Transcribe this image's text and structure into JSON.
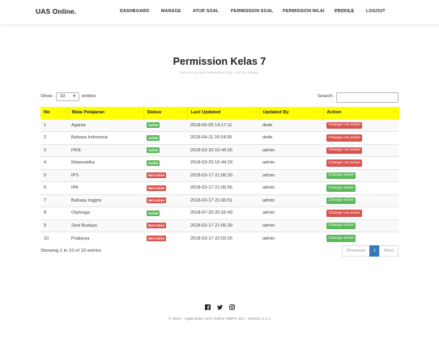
{
  "app": {
    "brand": "UAS Online."
  },
  "nav": {
    "items": [
      {
        "label": "DASHBOARD"
      },
      {
        "label": "MANAGE"
      },
      {
        "label": "ATUR SOAL"
      },
      {
        "label": "PERMISSION SOAL"
      },
      {
        "label": "PERMISSION NILAI"
      },
      {
        "label": "PROFILE"
      },
      {
        "label": "LOGOUT"
      }
    ],
    "active_item": "PROFILE"
  },
  "page": {
    "title": "Permission Kelas 7",
    "subtitle": "SERVITAH UNR REHBURA SOAL UNTUK SISWA"
  },
  "controls": {
    "show_label": "Show",
    "entries_value": "10",
    "entries_label": "entries",
    "search_label": "Search:",
    "search_value": ""
  },
  "table": {
    "columns": [
      "No",
      "Mata Pelajaran",
      "Status",
      "Last Updated",
      "Updated By",
      "Action"
    ],
    "rows": [
      {
        "no": "1",
        "subject": "Agama",
        "status": "Active",
        "updated": "2018-06-05 14:17:11",
        "by": "dede",
        "action": "Change not active"
      },
      {
        "no": "2",
        "subject": "Bahasa Indonesia",
        "status": "Active",
        "updated": "2018-04-11 20:24:36",
        "by": "dede",
        "action": "Change not active"
      },
      {
        "no": "3",
        "subject": "PKN",
        "status": "Active",
        "updated": "2018-03-20 10:44:26",
        "by": "admin",
        "action": "Change not active"
      },
      {
        "no": "4",
        "subject": "Matematika",
        "status": "Active",
        "updated": "2018-03-20 10:44:29",
        "by": "admin",
        "action": "Change not active"
      },
      {
        "no": "5",
        "subject": "IPS",
        "status": "Not Active",
        "updated": "2018-03-17 21:06:30",
        "by": "admin",
        "action": "Change active"
      },
      {
        "no": "6",
        "subject": "IPA",
        "status": "Not Active",
        "updated": "2018-03-17 21:06:56",
        "by": "admin",
        "action": "Change active"
      },
      {
        "no": "7",
        "subject": "Bahasa Inggris",
        "status": "Not Active",
        "updated": "2018-03-17 21:06:51",
        "by": "admin",
        "action": "Change active"
      },
      {
        "no": "8",
        "subject": "Olahraga",
        "status": "Active",
        "updated": "2018-07-20 20:16:49",
        "by": "admin",
        "action": "Change not active"
      },
      {
        "no": "9",
        "subject": "Seni Budaya",
        "status": "Not Active",
        "updated": "2018-03-17 21:06:39",
        "by": "admin",
        "action": "Change active"
      },
      {
        "no": "10",
        "subject": "Prakarya",
        "status": "Not Active",
        "updated": "2018-03-17 22:03:25",
        "by": "admin",
        "action": "Change active"
      }
    ]
  },
  "info": {
    "text": "Showing 1 to 10 of 10 entries"
  },
  "pagination": {
    "previous": "Previous",
    "current": "1",
    "next": "Next"
  },
  "footer": {
    "social_icons": [
      "facebook-icon",
      "twitter-icon",
      "instagram-icon"
    ],
    "text": "© 2019 - Application UAS Online SMPN 113 - Version 1.1.2"
  },
  "colors": {
    "header_bg": "#ffff00",
    "status_active": "#5cb85c",
    "status_not_active": "#d9534f",
    "pagination_active": "#337ab7"
  }
}
